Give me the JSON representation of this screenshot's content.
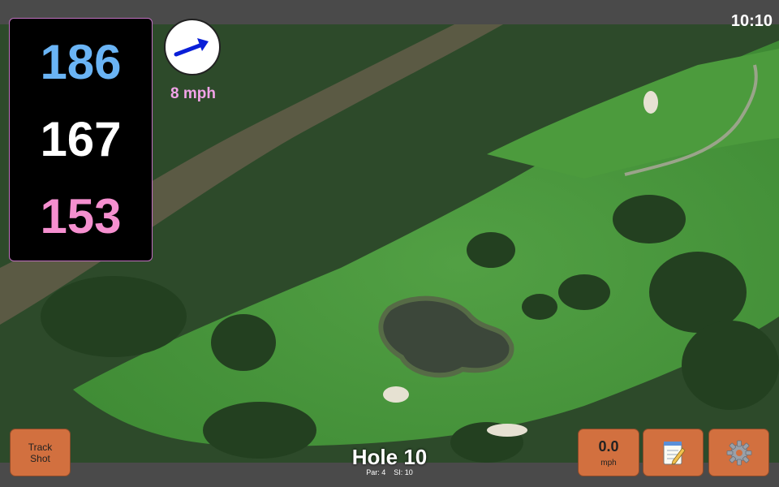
{
  "status": {
    "time": "10:10"
  },
  "yardage": {
    "back": "186",
    "middle": "167",
    "front": "153",
    "colors": {
      "back": "#6ab4f5",
      "middle": "#ffffff",
      "front": "#f58fcf"
    }
  },
  "wind": {
    "speed": "8 mph",
    "icon": "wind-arrow-icon"
  },
  "buttons": {
    "track_line1": "Track",
    "track_line2": "Shot",
    "speed_value": "0.0",
    "speed_unit": "mph",
    "notes_icon": "notepad-icon",
    "settings_icon": "gear-icon"
  },
  "hole": {
    "title": "Hole 10",
    "par": "Par: 4",
    "si": "SI: 10"
  },
  "colors": {
    "button": "#d2703f",
    "fairway": "#4f9a3e",
    "water": "#3e4a3c"
  }
}
